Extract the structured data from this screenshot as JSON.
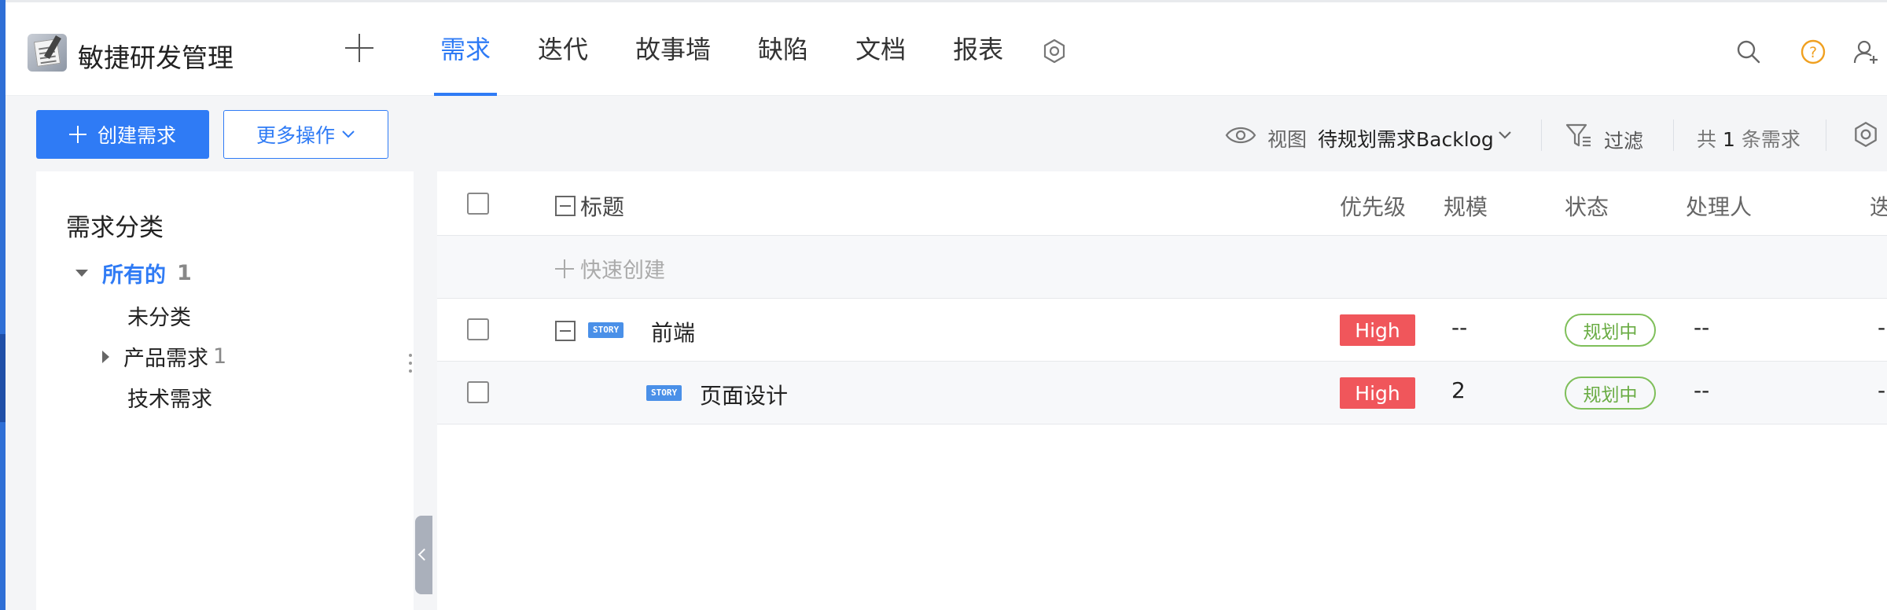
{
  "header": {
    "app_title": "敏捷研发管理",
    "nav_tabs": [
      {
        "label": "需求",
        "active": true
      },
      {
        "label": "迭代"
      },
      {
        "label": "故事墙"
      },
      {
        "label": "缺陷"
      },
      {
        "label": "文档"
      },
      {
        "label": "报表"
      }
    ],
    "icons": [
      "add-project-icon",
      "settings-gear-icon",
      "search-icon",
      "help-icon",
      "user-add-icon"
    ],
    "accent_color": "#2f7bf5"
  },
  "toolbar": {
    "create_label": "创建需求",
    "more_label": "更多操作",
    "view_label": "视图",
    "view_value": "待规划需求Backlog",
    "filter_label": "过滤",
    "count_prefix": "共",
    "count_value": "1",
    "count_suffix": "条需求"
  },
  "sidebar": {
    "title": "需求分类",
    "items": [
      {
        "label": "所有的",
        "count": "1"
      },
      {
        "label": "未分类"
      },
      {
        "label": "产品需求",
        "count": "1"
      },
      {
        "label": "技术需求"
      }
    ]
  },
  "table": {
    "columns": [
      "标题",
      "优先级",
      "规模",
      "状态",
      "处理人",
      "迭"
    ],
    "quick_create": "快速创建",
    "rows": [
      {
        "tag": "STORY",
        "title": "前端",
        "priority": "High",
        "size": "--",
        "status": "规划中",
        "assignee": "--",
        "sprint": "-"
      },
      {
        "tag": "STORY",
        "title": "页面设计",
        "priority": "High",
        "size": "2",
        "status": "规划中",
        "assignee": "--",
        "sprint": "-"
      }
    ],
    "priority_color": "#f0565b",
    "status_color": "#7fbf5a"
  }
}
